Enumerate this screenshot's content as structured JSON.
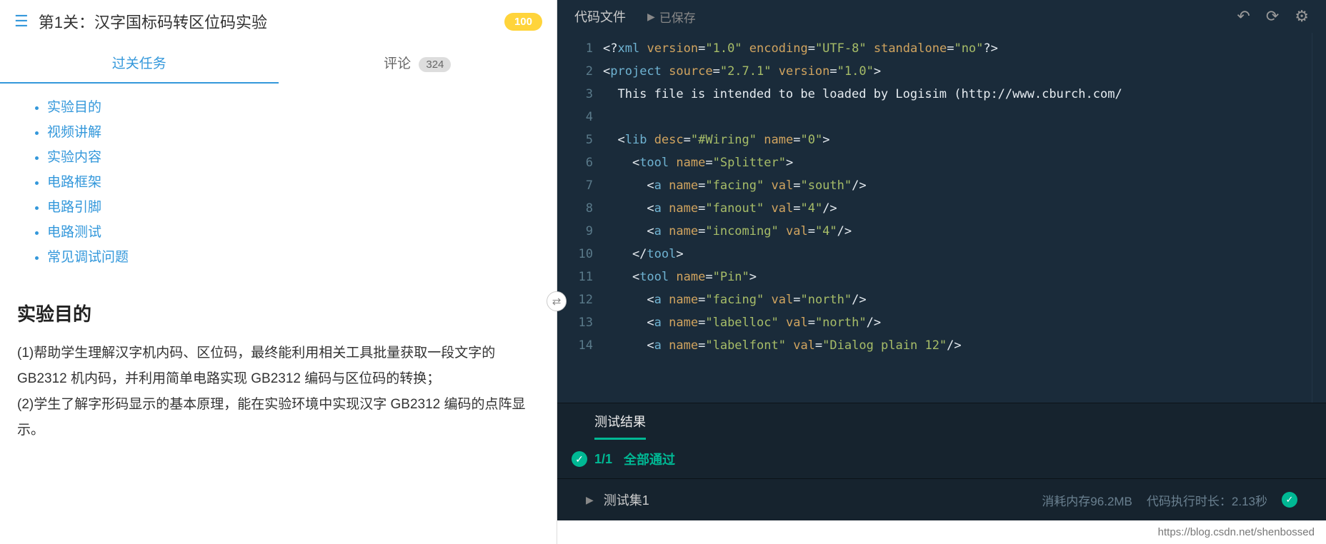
{
  "left": {
    "title": "第1关：汉字国标码转区位码实验",
    "score": "100",
    "tabs": {
      "task": "过关任务",
      "comments": "评论",
      "comments_count": "324"
    },
    "toc": [
      "实验目的",
      "视频讲解",
      "实验内容",
      "电路框架",
      "电路引脚",
      "电路测试",
      "常见调试问题"
    ],
    "section_title": "实验目的",
    "body": "(1)帮助学生理解汉字机内码、区位码，最终能利用相关工具批量获取一段文字的 GB2312 机内码，并利用简单电路实现 GB2312 编码与区位码的转换；\n(2)学生了解字形码显示的基本原理，能在实验环境中实现汉字 GB2312 编码的点阵显示。"
  },
  "right": {
    "file_title": "代码文件",
    "saved": "已保存",
    "line_numbers": [
      "1",
      "2",
      "3",
      "4",
      "5",
      "6",
      "7",
      "8",
      "9",
      "10",
      "11",
      "12",
      "13",
      "14"
    ],
    "code": [
      [
        [
          "<?",
          "punc"
        ],
        [
          "xml",
          "tag"
        ],
        [
          " ",
          "punc"
        ],
        [
          "version",
          "attr"
        ],
        [
          "=",
          "punc"
        ],
        [
          "\"1.0\"",
          "val"
        ],
        [
          " ",
          "punc"
        ],
        [
          "encoding",
          "attr"
        ],
        [
          "=",
          "punc"
        ],
        [
          "\"UTF-8\"",
          "val"
        ],
        [
          " ",
          "punc"
        ],
        [
          "standalone",
          "attr"
        ],
        [
          "=",
          "punc"
        ],
        [
          "\"no\"",
          "val"
        ],
        [
          "?>",
          "punc"
        ]
      ],
      [
        [
          "<",
          "punc"
        ],
        [
          "project",
          "tag"
        ],
        [
          " ",
          "punc"
        ],
        [
          "source",
          "orange"
        ],
        [
          "=",
          "punc"
        ],
        [
          "\"2.7.1\"",
          "val"
        ],
        [
          " ",
          "punc"
        ],
        [
          "version",
          "attr"
        ],
        [
          "=",
          "punc"
        ],
        [
          "\"1.0\"",
          "val"
        ],
        [
          ">",
          "punc"
        ]
      ],
      [
        [
          "  This file is intended to be loaded by Logisim (http://www.cburch.com/",
          "plain"
        ]
      ],
      [],
      [
        [
          "  <",
          "punc"
        ],
        [
          "lib",
          "tag"
        ],
        [
          " ",
          "punc"
        ],
        [
          "desc",
          "attr"
        ],
        [
          "=",
          "punc"
        ],
        [
          "\"#Wiring\"",
          "val"
        ],
        [
          " ",
          "punc"
        ],
        [
          "name",
          "attr"
        ],
        [
          "=",
          "punc"
        ],
        [
          "\"0\"",
          "val"
        ],
        [
          ">",
          "punc"
        ]
      ],
      [
        [
          "    <",
          "punc"
        ],
        [
          "tool",
          "tag"
        ],
        [
          " ",
          "punc"
        ],
        [
          "name",
          "attr"
        ],
        [
          "=",
          "punc"
        ],
        [
          "\"Splitter\"",
          "val"
        ],
        [
          ">",
          "punc"
        ]
      ],
      [
        [
          "      <",
          "punc"
        ],
        [
          "a",
          "tag"
        ],
        [
          " ",
          "punc"
        ],
        [
          "name",
          "attr"
        ],
        [
          "=",
          "punc"
        ],
        [
          "\"facing\"",
          "val"
        ],
        [
          " ",
          "punc"
        ],
        [
          "val",
          "attr"
        ],
        [
          "=",
          "punc"
        ],
        [
          "\"south\"",
          "val"
        ],
        [
          "/>",
          "punc"
        ]
      ],
      [
        [
          "      <",
          "punc"
        ],
        [
          "a",
          "tag"
        ],
        [
          " ",
          "punc"
        ],
        [
          "name",
          "attr"
        ],
        [
          "=",
          "punc"
        ],
        [
          "\"fanout\"",
          "val"
        ],
        [
          " ",
          "punc"
        ],
        [
          "val",
          "attr"
        ],
        [
          "=",
          "punc"
        ],
        [
          "\"4\"",
          "val"
        ],
        [
          "/>",
          "punc"
        ]
      ],
      [
        [
          "      <",
          "punc"
        ],
        [
          "a",
          "tag"
        ],
        [
          " ",
          "punc"
        ],
        [
          "name",
          "attr"
        ],
        [
          "=",
          "punc"
        ],
        [
          "\"incoming\"",
          "val"
        ],
        [
          " ",
          "punc"
        ],
        [
          "val",
          "attr"
        ],
        [
          "=",
          "punc"
        ],
        [
          "\"4\"",
          "val"
        ],
        [
          "/>",
          "punc"
        ]
      ],
      [
        [
          "    </",
          "punc"
        ],
        [
          "tool",
          "tag"
        ],
        [
          ">",
          "punc"
        ]
      ],
      [
        [
          "    <",
          "punc"
        ],
        [
          "tool",
          "tag"
        ],
        [
          " ",
          "punc"
        ],
        [
          "name",
          "attr"
        ],
        [
          "=",
          "punc"
        ],
        [
          "\"Pin\"",
          "val"
        ],
        [
          ">",
          "punc"
        ]
      ],
      [
        [
          "      <",
          "punc"
        ],
        [
          "a",
          "tag"
        ],
        [
          " ",
          "punc"
        ],
        [
          "name",
          "attr"
        ],
        [
          "=",
          "punc"
        ],
        [
          "\"facing\"",
          "val"
        ],
        [
          " ",
          "punc"
        ],
        [
          "val",
          "attr"
        ],
        [
          "=",
          "punc"
        ],
        [
          "\"north\"",
          "val"
        ],
        [
          "/>",
          "punc"
        ]
      ],
      [
        [
          "      <",
          "punc"
        ],
        [
          "a",
          "tag"
        ],
        [
          " ",
          "punc"
        ],
        [
          "name",
          "attr"
        ],
        [
          "=",
          "punc"
        ],
        [
          "\"labelloc\"",
          "val"
        ],
        [
          " ",
          "punc"
        ],
        [
          "val",
          "attr"
        ],
        [
          "=",
          "punc"
        ],
        [
          "\"north\"",
          "val"
        ],
        [
          "/>",
          "punc"
        ]
      ],
      [
        [
          "      <",
          "punc"
        ],
        [
          "a",
          "tag"
        ],
        [
          " ",
          "punc"
        ],
        [
          "name",
          "attr"
        ],
        [
          "=",
          "punc"
        ],
        [
          "\"labelfont\"",
          "val"
        ],
        [
          " ",
          "punc"
        ],
        [
          "val",
          "attr"
        ],
        [
          "=",
          "punc"
        ],
        [
          "\"Dialog plain 12\"",
          "val"
        ],
        [
          "/>",
          "punc"
        ]
      ]
    ]
  },
  "results": {
    "tab": "测试结果",
    "count": "1/1",
    "status": "全部通过",
    "set_name": "测试集1",
    "memory": "消耗内存96.2MB",
    "time": "代码执行时长：2.13秒"
  },
  "footer_url": "https://blog.csdn.net/shenbossed"
}
